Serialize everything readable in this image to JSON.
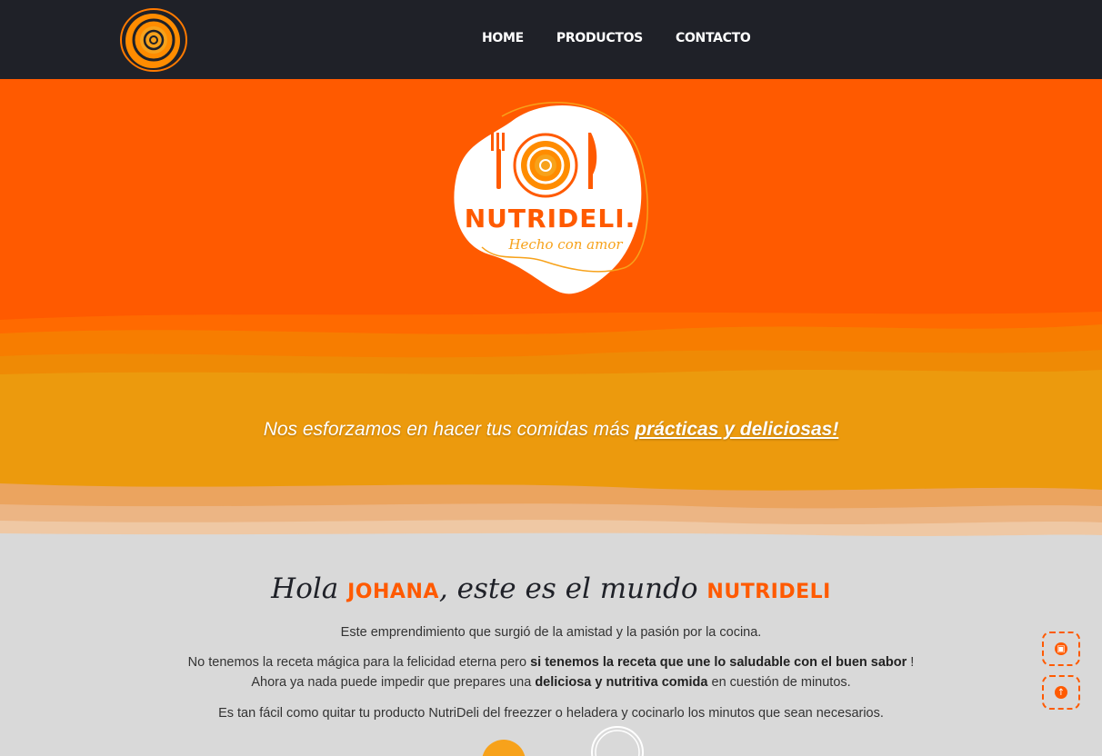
{
  "nav": {
    "items": [
      {
        "label": "HOME"
      },
      {
        "label": "PRODUCTOS"
      },
      {
        "label": "CONTACTO"
      }
    ]
  },
  "hero": {
    "logo_text": "NUTRIDELI.",
    "logo_script": "Hecho con amor",
    "tagline_prefix": "Nos esforzamos en hacer tus comidas más ",
    "tagline_link": "prácticas y deliciosas!"
  },
  "intro": {
    "greeting_hola": "Hola ",
    "greeting_name": "JOHANA",
    "greeting_mid": ", este es el mundo ",
    "greeting_brand": "NUTRIDELI",
    "p1": "Este emprendimiento que surgió de la amistad y la pasión por la cocina.",
    "p2_a": "No tenemos la receta mágica para la felicidad eterna pero ",
    "p2_b": "si tenemos la receta que une lo saludable con el buen sabor",
    "p2_c": " !",
    "p3_a": "Ahora ya nada puede impedir que prepares una ",
    "p3_b": "deliciosa y nutritiva comida",
    "p3_c": " en cuestión de minutos.",
    "p4": "Es tan fácil como quitar tu producto NutriDeli del freezzer o heladera y cocinarlo los minutos que sean necesarios."
  },
  "floating": {
    "cart_icon": "shopping-bag-icon",
    "top_icon": "arrow-up-icon",
    "cart_glyph": "▣",
    "top_glyph": "↑"
  },
  "colors": {
    "brand_orange": "#ff5a00",
    "amber": "#ec9a0d",
    "navbar": "#1f2128",
    "background": "#d9d9d9"
  }
}
